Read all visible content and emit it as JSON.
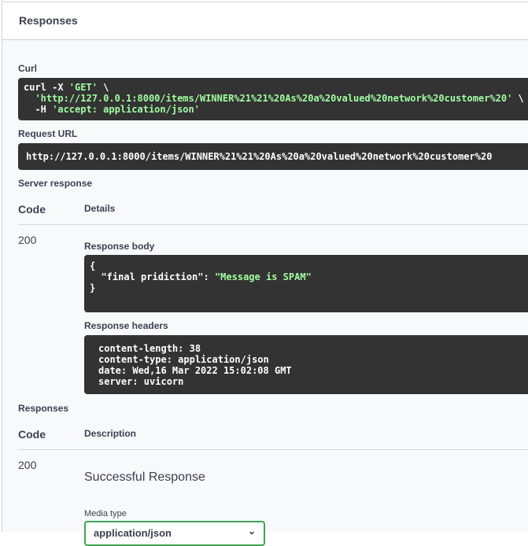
{
  "header": {
    "title": "Responses"
  },
  "curl": {
    "label": "Curl",
    "line1_prefix": "curl -X ",
    "line1_method": "'GET'",
    "line1_suffix": " \\",
    "line2_url": "'http://127.0.0.1:8000/items/WINNER%21%21%20As%20a%20valued%20network%20customer%20'",
    "line2_suffix": " \\",
    "line3_prefix": "  -H ",
    "line3_header": "'accept: application/json'"
  },
  "request_url": {
    "label": "Request URL",
    "value": "http://127.0.0.1:8000/items/WINNER%21%21%20As%20a%20valued%20network%20customer%20"
  },
  "server_response": {
    "label": "Server response",
    "col_code": "Code",
    "col_details": "Details",
    "code": "200",
    "body_label": "Response body",
    "body_open": "{",
    "body_key": "  \"final pridiction\": ",
    "body_value": "\"Message is SPAM\"",
    "body_close": "}",
    "headers_label": "Response headers",
    "headers": [
      "content-length: 38",
      "content-type: application/json",
      "date: Wed,16 Mar 2022 15:02:08 GMT",
      "server: uvicorn"
    ]
  },
  "responses": {
    "label": "Responses",
    "col_code": "Code",
    "col_description": "Description",
    "code": "200",
    "description": "Successful Response",
    "media_type_label": "Media type",
    "media_type_value": "application/json"
  }
}
